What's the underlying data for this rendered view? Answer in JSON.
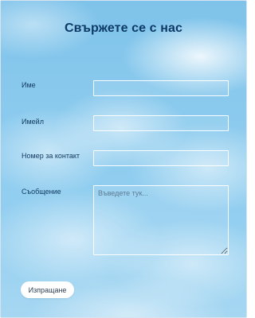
{
  "form": {
    "title": "Свържете се с нас",
    "fields": [
      {
        "label": "Име",
        "value": ""
      },
      {
        "label": "Имейл",
        "value": ""
      },
      {
        "label": "Номер за контакт",
        "value": ""
      }
    ],
    "message": {
      "label": "Съобщение",
      "placeholder": "Въведете тук..."
    },
    "submit_label": "Изпращане"
  }
}
